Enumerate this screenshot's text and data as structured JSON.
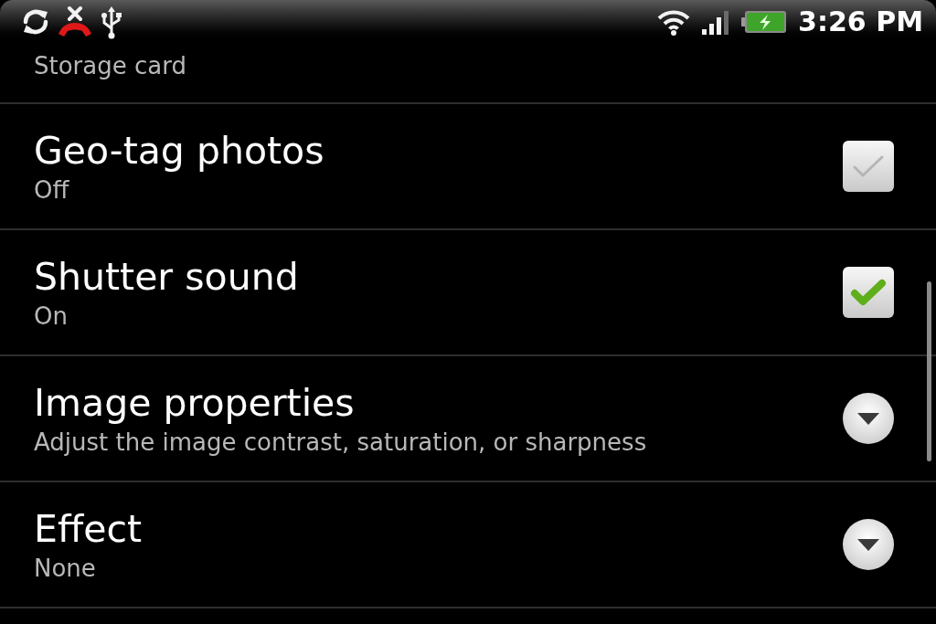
{
  "status_bar": {
    "time": "3:26 PM"
  },
  "settings": {
    "partial_item": {
      "summary": "Storage card"
    },
    "items": [
      {
        "kind": "checkbox",
        "title": "Geo-tag photos",
        "summary": "Off",
        "checked": false
      },
      {
        "kind": "checkbox",
        "title": "Shutter sound",
        "summary": "On",
        "checked": true
      },
      {
        "kind": "dropdown",
        "title": "Image properties",
        "summary": "Adjust the image contrast, saturation, or sharpness"
      },
      {
        "kind": "dropdown",
        "title": "Effect",
        "summary": "None"
      }
    ]
  }
}
